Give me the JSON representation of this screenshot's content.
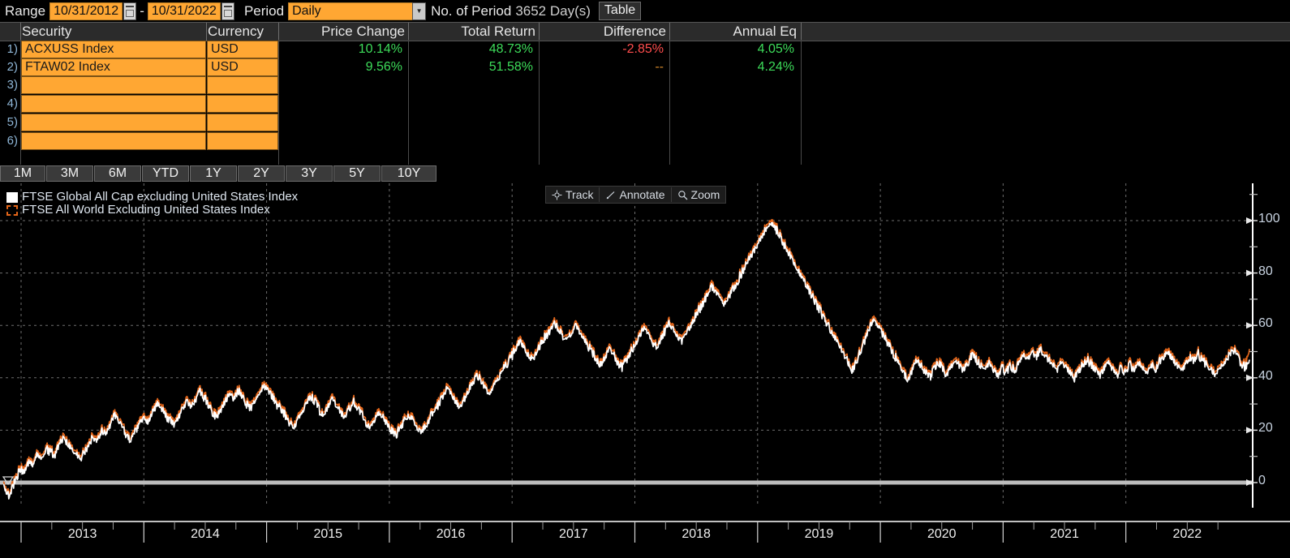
{
  "toolbar": {
    "range_label": "Range",
    "range_start": "10/31/2012",
    "range_end": "10/31/2022",
    "range_dash": "-",
    "period_label": "Period",
    "period_value": "Daily",
    "periods_label": "No. of Period",
    "periods_value": "3652 Day(s)",
    "table_button": "Table"
  },
  "table": {
    "headers": [
      "Security",
      "Currency",
      "Price Change",
      "Total Return",
      "Difference",
      "Annual Eq"
    ],
    "rows": [
      {
        "num": "1)",
        "security": "ACXUSS Index",
        "currency": "USD",
        "price_change": "10.14%",
        "total_return": "48.73%",
        "difference": "-2.85%",
        "annual_eq": "4.05%",
        "price_change_color": "green",
        "total_return_color": "green",
        "difference_color": "red",
        "annual_eq_color": "green"
      },
      {
        "num": "2)",
        "security": "FTAW02 Index",
        "currency": "USD",
        "price_change": "9.56%",
        "total_return": "51.58%",
        "difference": "--",
        "annual_eq": "4.24%",
        "price_change_color": "green",
        "total_return_color": "green",
        "difference_color": "dash",
        "annual_eq_color": "green"
      },
      {
        "num": "3)",
        "security": "",
        "currency": "",
        "price_change": "",
        "total_return": "",
        "difference": "",
        "annual_eq": ""
      },
      {
        "num": "4)",
        "security": "",
        "currency": "",
        "price_change": "",
        "total_return": "",
        "difference": "",
        "annual_eq": ""
      },
      {
        "num": "5)",
        "security": "",
        "currency": "",
        "price_change": "",
        "total_return": "",
        "difference": "",
        "annual_eq": ""
      },
      {
        "num": "6)",
        "security": "",
        "currency": "",
        "price_change": "",
        "total_return": "",
        "difference": "",
        "annual_eq": ""
      }
    ]
  },
  "range_buttons": [
    "1M",
    "3M",
    "6M",
    "YTD",
    "1Y",
    "2Y",
    "3Y",
    "5Y",
    "10Y"
  ],
  "chart_tools": [
    {
      "label": "Track",
      "icon": "crosshair-icon"
    },
    {
      "label": "Annotate",
      "icon": "pencil-icon"
    },
    {
      "label": "Zoom",
      "icon": "magnifier-icon"
    }
  ],
  "colors": {
    "series_white": "#ffffff",
    "series_orange": "#e4661a",
    "field_orange": "#ffa733",
    "positive": "#3ddc5a",
    "negative": "#ff4d4d",
    "background": "#000000",
    "gridline": "#6e6e6e"
  },
  "chart_data": {
    "type": "line",
    "title": "",
    "xlabel": "",
    "ylabel": "",
    "ylim": [
      -10,
      110
    ],
    "yticks": [
      0,
      20,
      40,
      60,
      80,
      100
    ],
    "yminor": [
      10,
      30,
      50,
      70,
      90,
      110
    ],
    "xticks": [
      "2013",
      "2014",
      "2015",
      "2016",
      "2017",
      "2018",
      "2019",
      "2020",
      "2021",
      "2022"
    ],
    "grid": true,
    "legend_position": "top-left",
    "zero_line": 0,
    "series": [
      {
        "name": "FTSE Global All Cap excluding United States Index",
        "color": "#ffffff",
        "style": "solid",
        "values": [
          0,
          -4,
          -2,
          3,
          6,
          5,
          9,
          8,
          12,
          10,
          14,
          13,
          11,
          15,
          18,
          16,
          14,
          12,
          10,
          13,
          16,
          19,
          17,
          21,
          20,
          23,
          27,
          25,
          22,
          19,
          17,
          21,
          24,
          26,
          24,
          28,
          31,
          29,
          27,
          25,
          23,
          26,
          29,
          32,
          30,
          33,
          36,
          34,
          31,
          28,
          26,
          29,
          32,
          35,
          33,
          36,
          34,
          31,
          29,
          32,
          35,
          38,
          36,
          34,
          31,
          29,
          27,
          24,
          22,
          25,
          28,
          31,
          34,
          32,
          29,
          27,
          30,
          33,
          31,
          28,
          26,
          29,
          32,
          30,
          27,
          24,
          22,
          25,
          28,
          26,
          23,
          21,
          19,
          22,
          25,
          27,
          25,
          22,
          20,
          23,
          26,
          29,
          31,
          34,
          37,
          35,
          32,
          30,
          33,
          36,
          39,
          42,
          40,
          37,
          35,
          38,
          41,
          44,
          46,
          49,
          52,
          55,
          53,
          50,
          48,
          51,
          54,
          57,
          59,
          62,
          60,
          57,
          55,
          58,
          61,
          59,
          56,
          53,
          51,
          48,
          46,
          49,
          52,
          50,
          47,
          45,
          48,
          51,
          54,
          57,
          60,
          58,
          55,
          53,
          56,
          59,
          62,
          60,
          57,
          55,
          58,
          61,
          64,
          67,
          70,
          73,
          76,
          74,
          71,
          69,
          72,
          75,
          78,
          81,
          84,
          87,
          90,
          93,
          96,
          99,
          101,
          98,
          95,
          92,
          89,
          86,
          83,
          80,
          77,
          74,
          71,
          68,
          65,
          62,
          59,
          56,
          53,
          50,
          47,
          44,
          48,
          52,
          56,
          60,
          64,
          61,
          58,
          55,
          52,
          49,
          46,
          43,
          40,
          44,
          48,
          46,
          43,
          41,
          44,
          47,
          45,
          42,
          45,
          48,
          46,
          44,
          47,
          50,
          48,
          46,
          44,
          47,
          44,
          42,
          45,
          43,
          46,
          44,
          47,
          50,
          48,
          51,
          49,
          52,
          50,
          48,
          46,
          44,
          47,
          45,
          43,
          41,
          44,
          46,
          48,
          46,
          44,
          42,
          45,
          47,
          44,
          42,
          45,
          43,
          46,
          44,
          47,
          45,
          43,
          46,
          44,
          47,
          49,
          51,
          48,
          46,
          44,
          46,
          49,
          47,
          50,
          48,
          46,
          44,
          42,
          45,
          47,
          49,
          52,
          50,
          47,
          45,
          48
        ],
        "end_value": 48.73
      },
      {
        "name": "FTSE All World Excluding United States Index",
        "color": "#e4661a",
        "style": "solid",
        "values": [
          0,
          -4,
          -2,
          3,
          6,
          5,
          9,
          8,
          12,
          10,
          14,
          13,
          11,
          15,
          18,
          16,
          14,
          12,
          10,
          13,
          16,
          19,
          17,
          21,
          20,
          23,
          27,
          25,
          22,
          19,
          17,
          21,
          24,
          26,
          24,
          28,
          31,
          29,
          27,
          25,
          23,
          26,
          29,
          32,
          30,
          33,
          36,
          34,
          31,
          28,
          26,
          29,
          32,
          35,
          33,
          36,
          34,
          31,
          29,
          32,
          35,
          38,
          36,
          34,
          31,
          29,
          27,
          24,
          22,
          25,
          28,
          31,
          34,
          32,
          29,
          27,
          30,
          33,
          31,
          28,
          26,
          29,
          32,
          30,
          27,
          24,
          22,
          25,
          28,
          26,
          23,
          21,
          19,
          22,
          25,
          27,
          25,
          22,
          20,
          23,
          26,
          29,
          31,
          34,
          37,
          35,
          32,
          30,
          33,
          36,
          39,
          42,
          40,
          37,
          35,
          38,
          41,
          44,
          46,
          49,
          52,
          55,
          53,
          50,
          48,
          51,
          54,
          57,
          59,
          62,
          60,
          57,
          55,
          58,
          61,
          59,
          56,
          53,
          51,
          48,
          46,
          49,
          52,
          50,
          47,
          45,
          48,
          51,
          54,
          57,
          60,
          58,
          55,
          53,
          56,
          59,
          62,
          60,
          57,
          55,
          58,
          61,
          64,
          67,
          70,
          73,
          76,
          74,
          71,
          69,
          72,
          75,
          78,
          81,
          84,
          87,
          90,
          93,
          96,
          99,
          101,
          98,
          95,
          92,
          89,
          86,
          83,
          80,
          77,
          74,
          71,
          68,
          65,
          62,
          59,
          56,
          53,
          50,
          47,
          44,
          48,
          52,
          56,
          60,
          64,
          61,
          58,
          55,
          52,
          49,
          46,
          43,
          40,
          44,
          48,
          46,
          43,
          41,
          44,
          47,
          45,
          42,
          45,
          48,
          46,
          44,
          47,
          50,
          48,
          46,
          44,
          47,
          44,
          42,
          45,
          43,
          46,
          44,
          47,
          50,
          48,
          51,
          49,
          52,
          50,
          48,
          46,
          44,
          47,
          45,
          43,
          41,
          44,
          46,
          48,
          46,
          44,
          42,
          45,
          47,
          44,
          42,
          45,
          43,
          46,
          44,
          47,
          45,
          43,
          46,
          44,
          47,
          49,
          51,
          48,
          46,
          44,
          46,
          49,
          47,
          50,
          48,
          46,
          44,
          42,
          45,
          47,
          49,
          52,
          50,
          47,
          45,
          51
        ],
        "end_value": 51.58
      }
    ]
  }
}
